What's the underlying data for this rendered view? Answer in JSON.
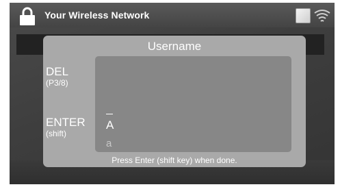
{
  "header": {
    "title": "Your Wireless Network",
    "lock_icon": "lock-icon",
    "status_icon": "status-square-icon",
    "wifi_icon": "wifi-signal-icon"
  },
  "dialog": {
    "title": "Username",
    "del_label": "DEL",
    "del_sub": "(P3/8)",
    "enter_label": "ENTER",
    "enter_sub": "(shift)",
    "cursor_char": "_",
    "upper_char": "A",
    "lower_char": "a",
    "hint": "Press Enter (shift key) when done."
  },
  "colors": {
    "dialog_bg": "#a9a9a9",
    "input_bg": "#878787",
    "titlebar_bg": "#4a4a4a"
  }
}
